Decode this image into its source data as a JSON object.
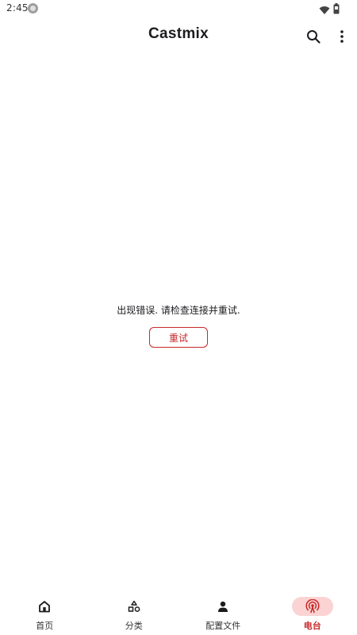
{
  "status_bar": {
    "time": "2:45",
    "app_icon": "cast-notification-icon",
    "wifi_icon": "wifi-icon",
    "battery_icon": "battery-icon"
  },
  "app_bar": {
    "title": "Castmix",
    "search_icon": "search-icon",
    "more_icon": "more-vert-icon"
  },
  "main": {
    "error_message": "出现错误. 请检查连接并重试.",
    "retry_label": "重试"
  },
  "bottom_nav": {
    "items": [
      {
        "label": "首页",
        "icon": "home-icon",
        "active": false
      },
      {
        "label": "分类",
        "icon": "category-icon",
        "active": false
      },
      {
        "label": "配置文件",
        "icon": "profile-icon",
        "active": false
      },
      {
        "label": "电台",
        "icon": "radio-icon",
        "active": true
      }
    ]
  },
  "colors": {
    "accent": "#c62828",
    "active_pill": "#fbd3d3",
    "text": "#1c1b1f"
  }
}
